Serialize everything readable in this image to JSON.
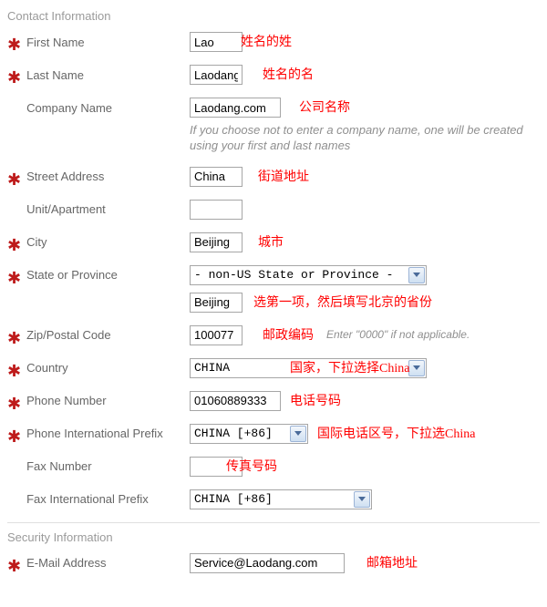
{
  "sections": {
    "contact": "Contact Information",
    "security": "Security Information"
  },
  "labels": {
    "firstName": "First Name",
    "lastName": "Last Name",
    "companyName": "Company Name",
    "streetAddress": "Street Address",
    "unit": "Unit/Apartment",
    "city": "City",
    "state": "State or Province",
    "zip": "Zip/Postal Code",
    "country": "Country",
    "phone": "Phone Number",
    "phonePrefix": "Phone International Prefix",
    "fax": "Fax Number",
    "faxPrefix": "Fax International Prefix",
    "email": "E-Mail Address"
  },
  "values": {
    "firstName": "Lao",
    "lastName": "Laodang",
    "companyName": "Laodang.com",
    "streetAddress": "China",
    "unit": "",
    "city": "Beijing",
    "stateSelect": "- non-US State or Province -",
    "stateText": "Beijing",
    "zip": "100077",
    "countrySelect": "CHINA",
    "phone": "01060889333",
    "phonePrefixSelect": "CHINA [+86]",
    "fax": "",
    "faxPrefixSelect": "CHINA [+86]",
    "email": "Service@Laodang.com"
  },
  "hints": {
    "companyNote": "If you choose not to enter a company name, one will be created using your first and last names",
    "zipNote": "Enter \"0000\" if not applicable."
  },
  "annotations": {
    "firstName": "姓名的姓",
    "lastName": "姓名的名",
    "companyName": "公司名称",
    "streetAddress": "街道地址",
    "city": "城市",
    "stateNote": "选第一项，然后填写北京的省份",
    "zip": "邮政编码",
    "country": "国家，下拉选择China",
    "phone": "电话号码",
    "phonePrefix": "国际电话区号，下拉选China",
    "fax": "传真号码",
    "email": "邮箱地址"
  }
}
